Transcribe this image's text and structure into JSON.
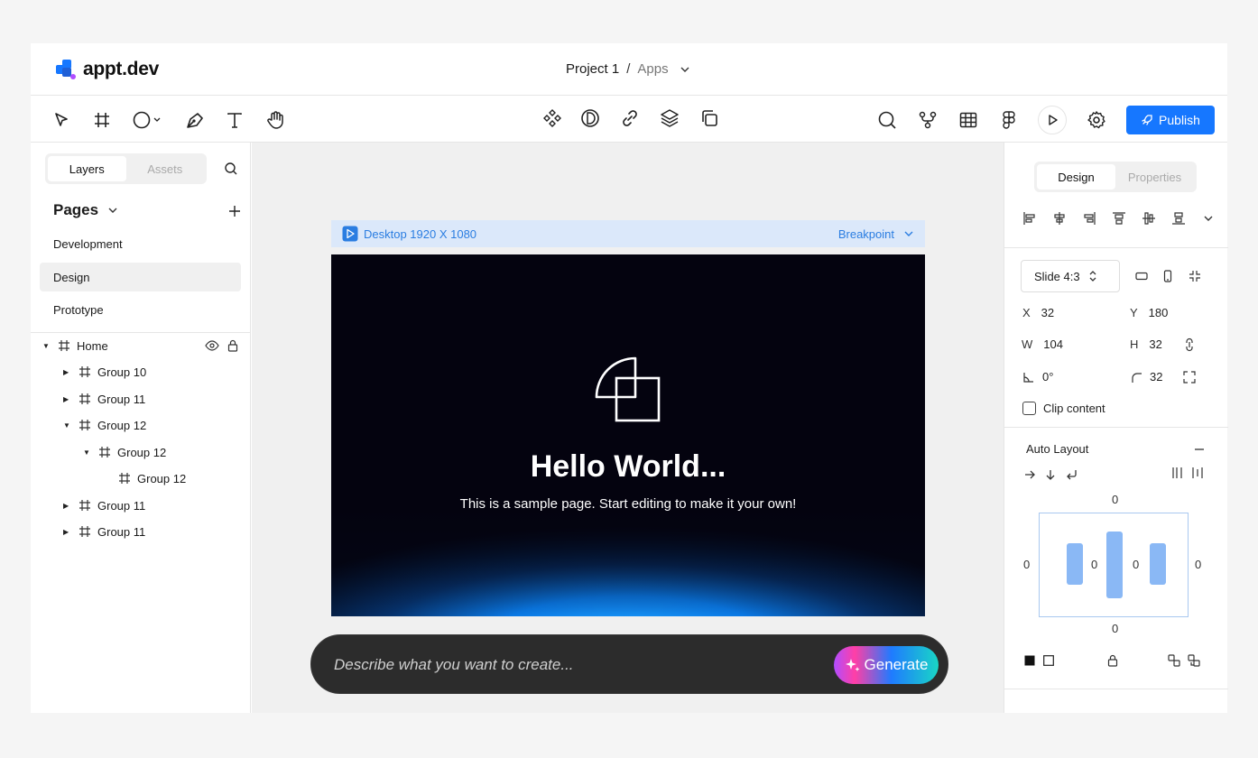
{
  "brand": {
    "name": "appt.dev"
  },
  "breadcrumb": {
    "project": "Project 1",
    "separator": "/",
    "section": "Apps"
  },
  "toolbar": {
    "left_tools": [
      "cursor-icon",
      "frame-icon",
      "shape-icon",
      "pen-icon",
      "text-icon",
      "hand-icon"
    ],
    "center_tools": [
      "component-icon",
      "contrast-icon",
      "link-icon",
      "layers-icon",
      "duplicate-icon"
    ],
    "right_tools": [
      "search-icon",
      "branch-icon",
      "table-icon",
      "figma-icon",
      "play-icon",
      "settings-icon"
    ],
    "publish_label": "Publish"
  },
  "left_panel": {
    "tabs": [
      "Layers",
      "Assets"
    ],
    "pages_title": "Pages",
    "pages": [
      "Development",
      "Design",
      "Prototype"
    ],
    "selected_page": "Design",
    "tree": [
      {
        "label": "Home",
        "depth": 0,
        "state": "expanded"
      },
      {
        "label": "Group 10",
        "depth": 1,
        "state": "collapsed"
      },
      {
        "label": "Group 11",
        "depth": 1,
        "state": "collapsed"
      },
      {
        "label": "Group 12",
        "depth": 1,
        "state": "expanded"
      },
      {
        "label": "Group 12",
        "depth": 2,
        "state": "expanded"
      },
      {
        "label": "Group 12",
        "depth": 3,
        "state": "leaf"
      },
      {
        "label": "Group 11",
        "depth": 1,
        "state": "collapsed"
      },
      {
        "label": "Group 11",
        "depth": 1,
        "state": "collapsed"
      }
    ]
  },
  "canvas": {
    "frame_label": "Desktop 1920 X 1080",
    "breakpoint_label": "Breakpoint",
    "heading": "Hello World...",
    "subtext": "This is a sample page. Start editing to make it your own!"
  },
  "prompt": {
    "placeholder": "Describe what you want to create...",
    "button": "Generate"
  },
  "right_panel": {
    "tabs": [
      "Design",
      "Properties"
    ],
    "preset": "Slide 4:3",
    "x_label": "X",
    "x": "32",
    "y_label": "Y",
    "y": "180",
    "w_label": "W",
    "w": "104",
    "h_label": "H",
    "h": "32",
    "rotation": "0°",
    "radius": "32",
    "clip_content": "Clip content",
    "auto_layout_title": "Auto Layout",
    "padding": {
      "top": "0",
      "bottom": "0",
      "left": "0",
      "right": "0",
      "gap1": "0",
      "gap2": "0"
    }
  },
  "colors": {
    "accent": "#1677ff",
    "frame_bar": "#dbe8fa",
    "al_bar": "#8ab8f5"
  }
}
